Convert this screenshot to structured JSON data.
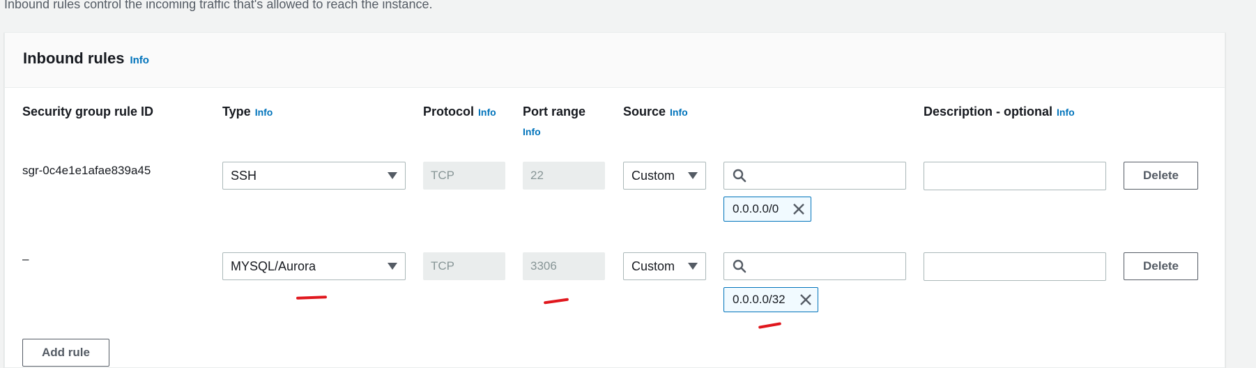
{
  "intro_text": "Inbound rules control the incoming traffic that's allowed to reach the instance.",
  "panel": {
    "title": "Inbound rules",
    "info": "Info"
  },
  "columns": {
    "rule_id": "Security group rule ID",
    "type": "Type",
    "protocol": "Protocol",
    "port_range": "Port range",
    "source": "Source",
    "description": "Description - optional",
    "info": "Info"
  },
  "rules": [
    {
      "rule_id": "sgr-0c4e1e1afae839a45",
      "type": "SSH",
      "protocol": "TCP",
      "port_range": "22",
      "source": "Custom",
      "search_value": "",
      "cidr_token": "0.0.0.0/0",
      "description": "",
      "delete_label": "Delete"
    },
    {
      "rule_id": "–",
      "type": "MYSQL/Aurora",
      "protocol": "TCP",
      "port_range": "3306",
      "source": "Custom",
      "search_value": "",
      "cidr_token": "0.0.0.0/32",
      "description": "",
      "delete_label": "Delete"
    }
  ],
  "add_rule_label": "Add rule",
  "icons": {
    "search": "search-icon",
    "caret": "caret-down-icon",
    "remove": "close-icon"
  },
  "colors": {
    "link": "#0073bb",
    "annotation": "#e0171d"
  }
}
